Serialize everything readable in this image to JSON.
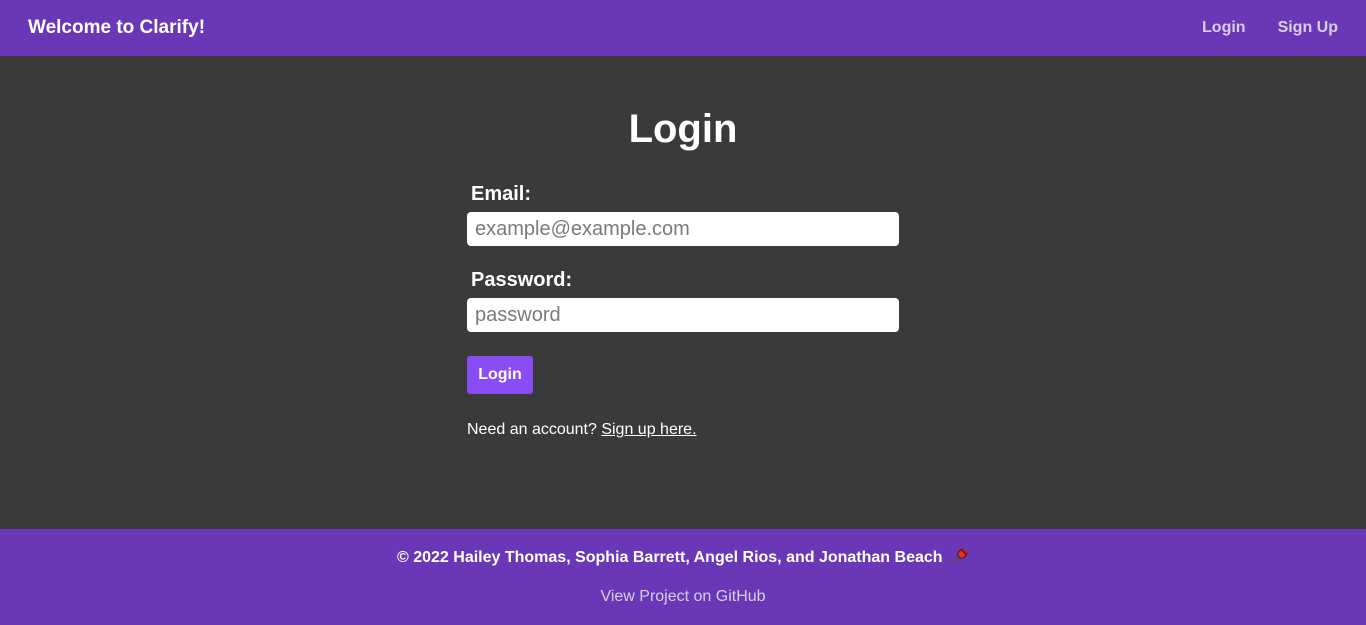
{
  "navbar": {
    "brand": "Welcome to Clarify!",
    "links": [
      {
        "label": "Login"
      },
      {
        "label": "Sign Up"
      }
    ]
  },
  "main": {
    "title": "Login",
    "email": {
      "label": "Email:",
      "placeholder": "example@example.com",
      "value": ""
    },
    "password": {
      "label": "Password:",
      "placeholder": "password",
      "value": ""
    },
    "submit_label": "Login",
    "signup_prompt": "Need an account?",
    "signup_link": "Sign up here."
  },
  "footer": {
    "copyright": "© 2022 Hailey Thomas, Sophia Barrett, Angel Rios, and Jonathan Beach",
    "icon": "pushpin-icon",
    "github_link": "View Project on GitHub"
  },
  "colors": {
    "nav_bg": "#6a38b6",
    "page_bg": "#3a3a3a",
    "button_bg": "#8a4df5",
    "link_muted": "#d9cdee"
  }
}
